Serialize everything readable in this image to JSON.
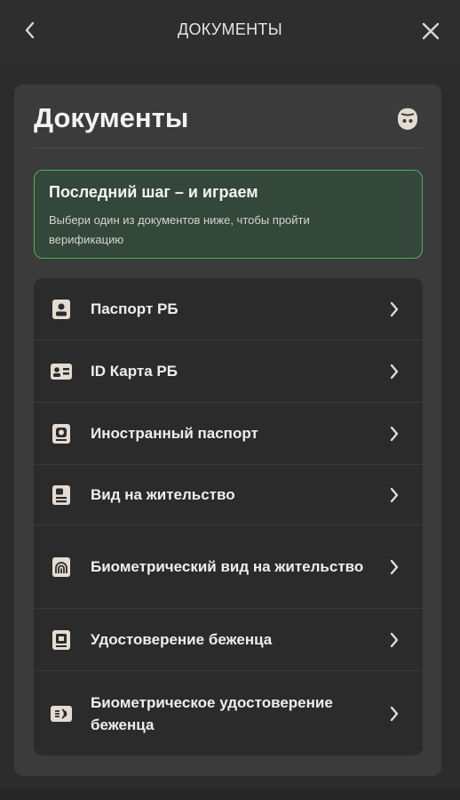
{
  "header": {
    "title": "ДОКУМЕНТЫ",
    "back_icon": "chevron-left-icon",
    "close_icon": "close-icon"
  },
  "panel": {
    "title": "Документы",
    "support_icon": "support-agent-icon"
  },
  "notice": {
    "title": "Последний шаг – и играем",
    "text": "Выбери один из документов ниже, чтобы пройти верификацию"
  },
  "documents": [
    {
      "label": "Паспорт РБ",
      "icon": "passport-icon"
    },
    {
      "label": "ID Карта РБ",
      "icon": "id-card-icon"
    },
    {
      "label": "Иностранный паспорт",
      "icon": "foreign-passport-icon"
    },
    {
      "label": "Вид на жительство",
      "icon": "residence-permit-icon"
    },
    {
      "label": "Биометрический вид на жительство",
      "icon": "biometric-residence-permit-icon"
    },
    {
      "label": "Удостоверение беженца",
      "icon": "refugee-certificate-icon"
    },
    {
      "label": "Биометрическое удостоверение беженца",
      "icon": "biometric-refugee-certificate-icon"
    }
  ],
  "colors": {
    "background": "#2c2c2c",
    "panel": "#3b3b3b",
    "list": "#2b2b2b",
    "notice_bg": "#33473a",
    "notice_border": "#4fae62",
    "icon": "#e4dcd2"
  }
}
